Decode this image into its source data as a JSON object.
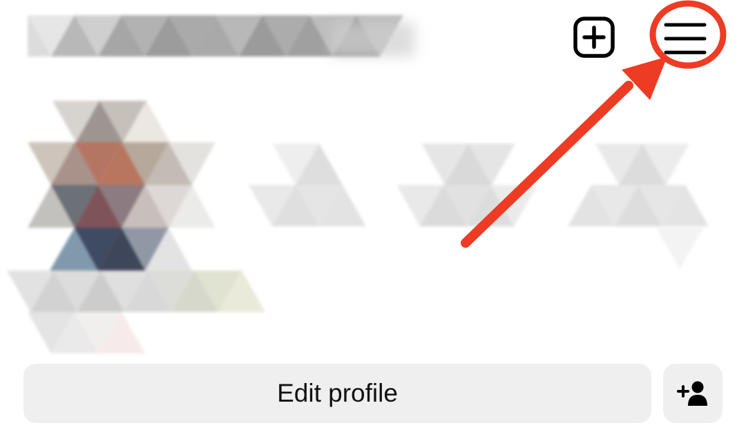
{
  "header": {
    "username": "",
    "new_post_icon": "plus-square-icon",
    "menu_icon": "hamburger-menu-icon"
  },
  "annotation": {
    "highlight_color": "#ee3b24",
    "description_icon": "red-circle-and-arrow"
  },
  "profile": {
    "avatar_obscured": true,
    "stats_obscured": true
  },
  "actions": {
    "edit_profile_label": "Edit profile",
    "add_user_icon": "add-person-icon"
  }
}
